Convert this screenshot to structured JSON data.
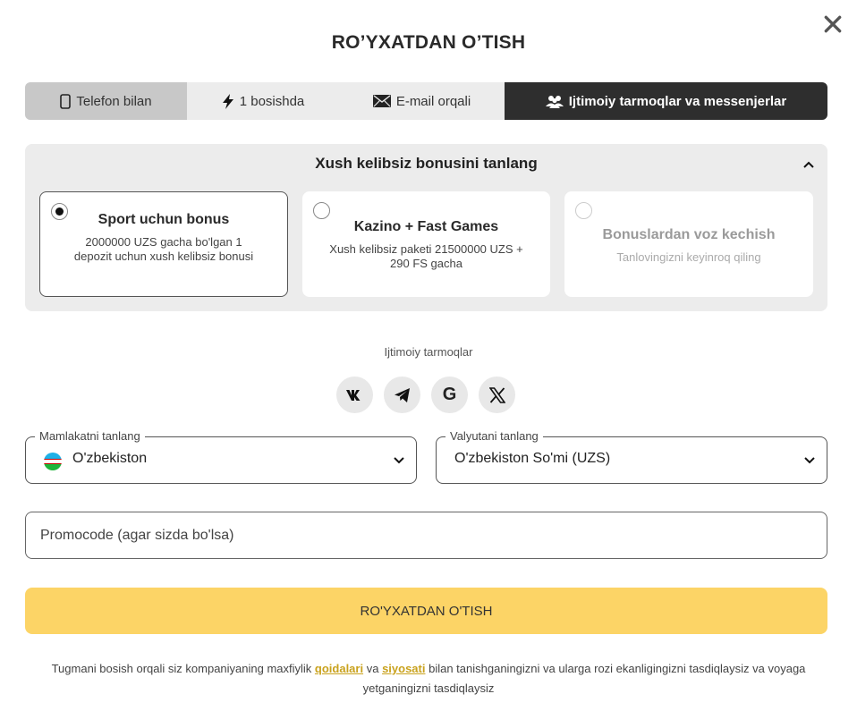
{
  "modal": {
    "title": "RO’YXATDAN O’TISH",
    "close_icon": "close-icon"
  },
  "tabs": [
    {
      "label": "Telefon bilan",
      "icon": "phone-icon",
      "active": false
    },
    {
      "label": "1 bosishda",
      "icon": "lightning-icon",
      "active": false
    },
    {
      "label": "E-mail orqali",
      "icon": "envelope-icon",
      "active": false
    },
    {
      "label": "Ijtimoiy tarmoqlar va messenjerlar",
      "icon": "users-icon",
      "active": true
    }
  ],
  "bonus": {
    "heading": "Xush kelibsiz bonusini tanlang",
    "options": [
      {
        "title": "Sport uchun bonus",
        "desc": "2000000 UZS gacha bo'lgan 1 depozit uchun xush kelibsiz bonusi",
        "selected": true
      },
      {
        "title": "Kazino + Fast Games",
        "desc": "Xush kelibsiz paketi 21500000 UZS + 290 FS gacha",
        "selected": false
      },
      {
        "title": "Bonuslardan voz kechish",
        "desc": "Tanlovingizni keyinroq qiling",
        "selected": false
      }
    ]
  },
  "social": {
    "label": "Ijtimoiy tarmoqlar",
    "networks": [
      {
        "name": "vk-icon",
        "glyph": "ʬ"
      },
      {
        "name": "telegram-icon",
        "glyph": ""
      },
      {
        "name": "google-icon",
        "glyph": "G"
      },
      {
        "name": "x-icon",
        "glyph": "𝕏"
      }
    ]
  },
  "country": {
    "label": "Mamlakatni tanlang",
    "value": "O'zbekiston",
    "flag_colors": [
      "#1eb1e7",
      "#ffffff",
      "#1eb53a"
    ]
  },
  "currency": {
    "label": "Valyutani tanlang",
    "value": "O'zbekiston So'mi (UZS)"
  },
  "promo": {
    "placeholder": "Promocode (agar sizda bo'lsa)"
  },
  "submit": {
    "label": "RO'YXATDAN O'TISH",
    "color": "#fcd466"
  },
  "terms": {
    "text_before": "Tugmani bosish orqali siz kompaniyaning maxfiylik ",
    "link1": "qoidalari",
    "text_mid": " va ",
    "link2": "siyosati",
    "text_after": " bilan tanishganingizni va ularga rozi ekanligingizni tasdiqlaysiz va voyaga yetganingizni tasdiqlaysiz"
  }
}
